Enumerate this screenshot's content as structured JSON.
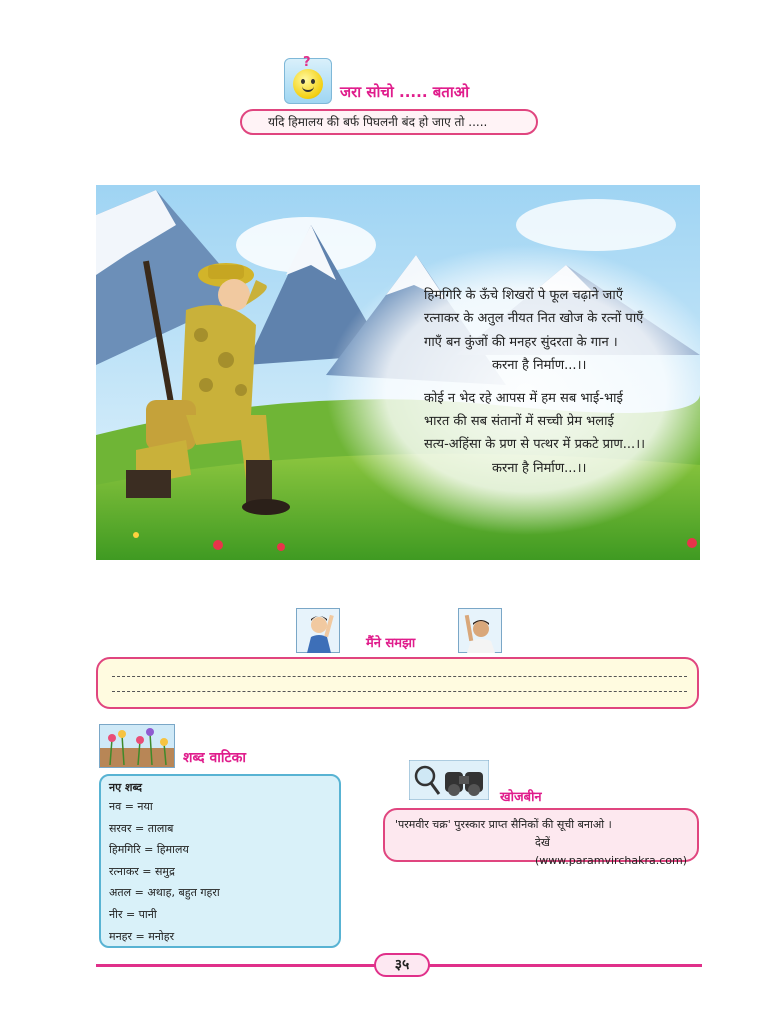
{
  "think": {
    "title": "जरा सोचो ..... बताओ",
    "question": "यदि हिमालय की बर्फ पिघलनी बंद हो जाए तो ....."
  },
  "poem": {
    "stanza1": [
      "हिमगिरि के ऊँचे शिखरों पे फूल चढ़ाने जाएँ",
      "रत्नाकर के अतुल नीयत नित खोज के रत्नों पाएँ",
      "गाएँ बन कुंजों की मनहर सुंदरता के गान ।"
    ],
    "refrain1": "करना है निर्माण...।।",
    "stanza2": [
      "कोई न भेद रहे आपस में हम सब भाई-भाई",
      "भारत की सब संतानों में सच्ची प्रेम भलाई",
      "सत्य-अहिंसा के प्रण से पत्थर में प्रकटे प्राण...।।"
    ],
    "refrain2": "करना है निर्माण...।।"
  },
  "learned": {
    "title": "मैंने समझा"
  },
  "words": {
    "title": "शब्द वाटिका",
    "heading": "नए शब्द",
    "list": [
      "नव = नया",
      "सरवर = तालाब",
      "हिमगिरि = हिमालय",
      "रत्नाकर = समुद्र",
      "अतल = अथाह, बहुत गहरा",
      "नीर = पानी",
      "मनहर = मनोहर"
    ]
  },
  "explore": {
    "title": "खोजबीन",
    "line1": "'परमवीर चक्र' पुरस्कार प्राप्त सैनिकों की सूची बनाओ ।",
    "line2": "देखें (www.paramvirchakra.com)"
  },
  "page_number": "३५",
  "colors": {
    "accent": "#e01d8c",
    "box_border": "#e0457f",
    "blue_border": "#58b3d3"
  }
}
